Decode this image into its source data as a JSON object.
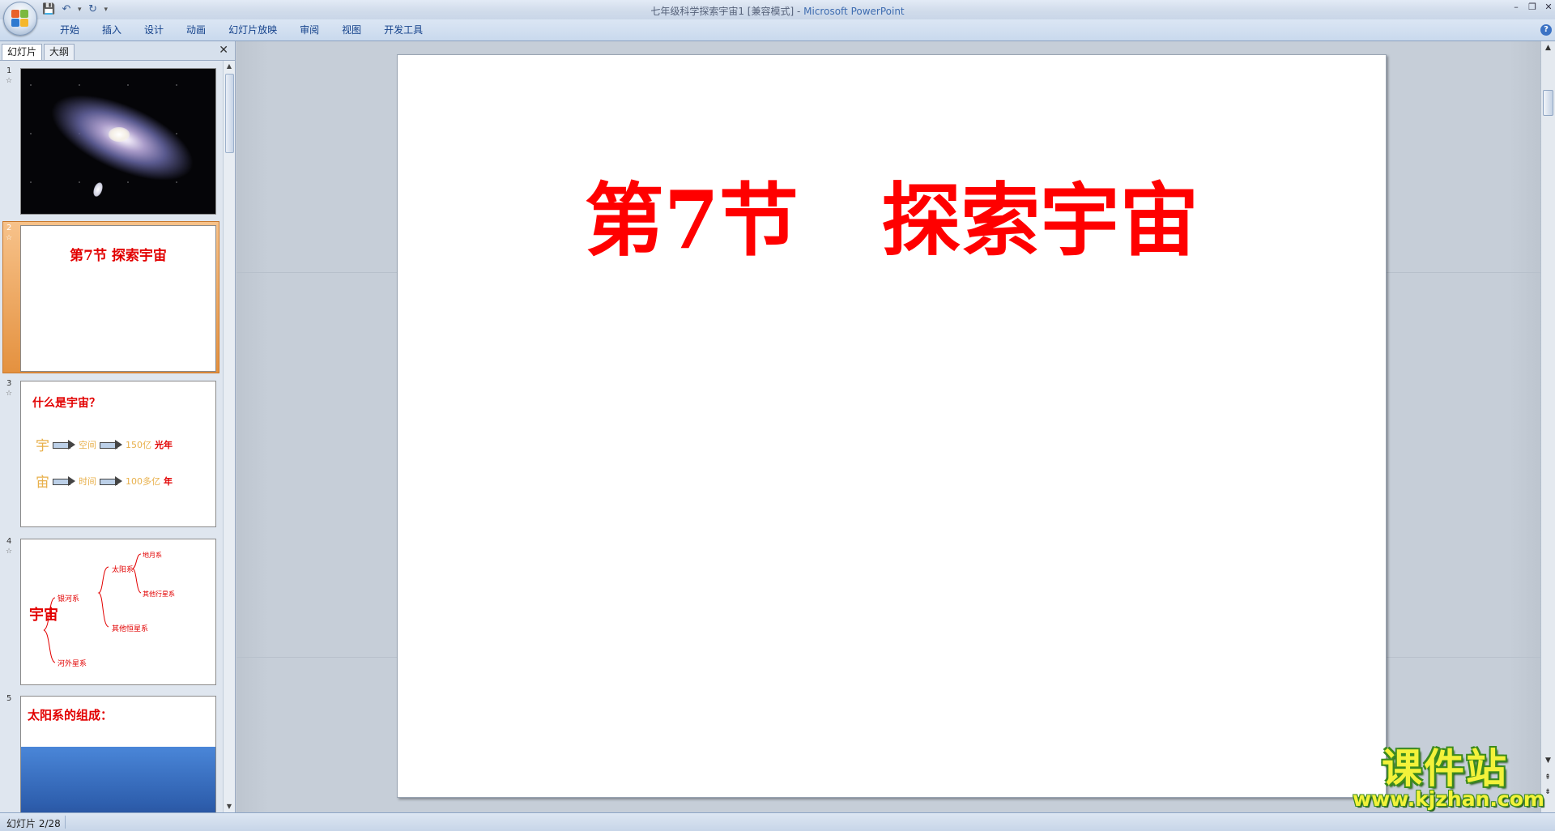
{
  "window": {
    "title": "七年级科学探索宇宙1 [兼容模式]",
    "title_sep": " - ",
    "app_name": "Microsoft PowerPoint",
    "controls": [
      "–",
      "❐",
      "✕"
    ]
  },
  "quick_access": {
    "save_icon": "save-icon",
    "undo_icon": "undo-icon",
    "redo_icon": "redo-icon",
    "customize_icon": "dropdown-icon"
  },
  "ribbon": {
    "tabs": [
      "开始",
      "插入",
      "设计",
      "动画",
      "幻灯片放映",
      "审阅",
      "视图",
      "开发工具"
    ],
    "help_label": "?"
  },
  "left_pane": {
    "tabs": [
      "幻灯片",
      "大纲"
    ],
    "close_label": "✕",
    "slides": [
      {
        "num": "1",
        "type": "galaxy-image"
      },
      {
        "num": "2",
        "title": "第7节  探索宇宙",
        "selected": true
      },
      {
        "num": "3",
        "title": "什么是宇宙？",
        "row1": {
          "big": "宇",
          "mid": "空间",
          "num": "150亿",
          "unit": "光年"
        },
        "row2": {
          "big": "宙",
          "mid": "时间",
          "num": "100多亿",
          "unit": "年"
        }
      },
      {
        "num": "4",
        "big": "宇宙",
        "labels": {
          "galaxy": "银河系",
          "solar": "太阳系",
          "earth_moon": "地月系",
          "other_planets": "其他行星系",
          "other_stars": "其他恒星系",
          "extragalactic": "河外星系"
        }
      },
      {
        "num": "5",
        "title": "太阳系的组成："
      }
    ]
  },
  "slide": {
    "title": "第7节   探索宇宙",
    "title_color": "#ff0000"
  },
  "status": {
    "text": "幻灯片 2/28"
  },
  "watermark": {
    "main": "课件站",
    "url": "www.kjzhan.com"
  }
}
